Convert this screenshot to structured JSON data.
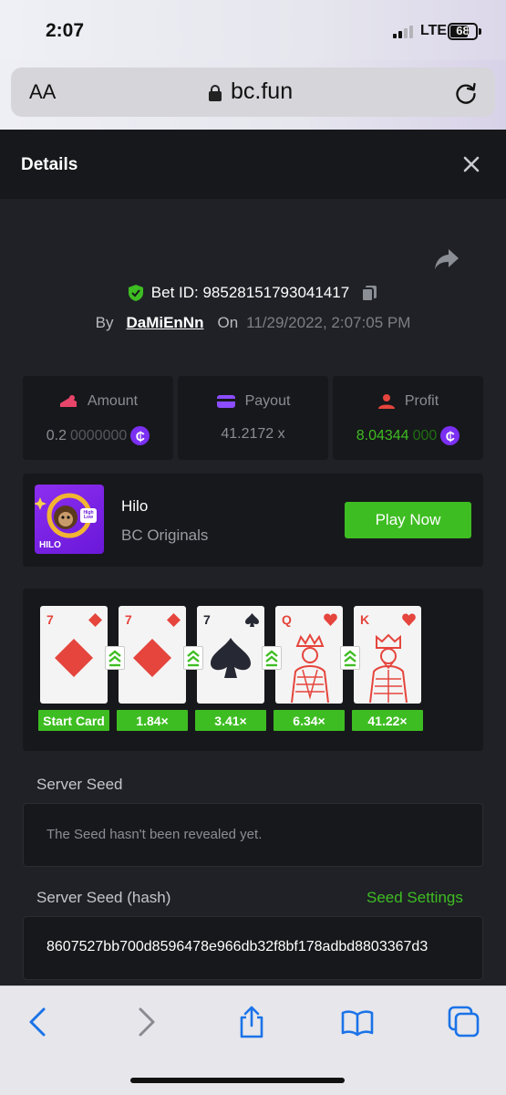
{
  "status_bar": {
    "time": "2:07",
    "network": "LTE",
    "battery": "68"
  },
  "browser": {
    "text_size": "AA",
    "url": "bc.fun"
  },
  "modal": {
    "title": "Details"
  },
  "bet": {
    "id_label": "Bet ID: 98528151793041417",
    "by_label": "By",
    "username": "DaMiEnNn",
    "on_label": "On",
    "datetime": "11/29/2022, 2:07:05 PM"
  },
  "stats": {
    "amount": {
      "label": "Amount",
      "value_lead": "0.2",
      "value_trail": "0000000"
    },
    "payout": {
      "label": "Payout",
      "value": "41.2172 x"
    },
    "profit": {
      "label": "Profit",
      "value_lead": "8.04344",
      "value_trail": "000"
    },
    "coin_symbol": "₵"
  },
  "game": {
    "name": "Hilo",
    "provider": "BC Originals",
    "play_label": "Play Now",
    "thumb_label": "HILO",
    "thumb_badge": "High Low"
  },
  "cards": [
    {
      "rank": "7",
      "suit": "diamond",
      "multiplier": "Start Card"
    },
    {
      "rank": "7",
      "suit": "diamond",
      "multiplier": "1.84×"
    },
    {
      "rank": "7",
      "suit": "spade",
      "multiplier": "3.41×"
    },
    {
      "rank": "Q",
      "suit": "heart",
      "multiplier": "6.34×"
    },
    {
      "rank": "K",
      "suit": "heart",
      "multiplier": "41.22×"
    }
  ],
  "server_seed": {
    "label": "Server Seed",
    "message": "The Seed hasn't been revealed yet."
  },
  "server_seed_hash": {
    "label": "Server Seed (hash)",
    "settings_link": "Seed Settings",
    "value": "8607527bb700d8596478e966db32f8bf178adbd8803367d3"
  },
  "colors": {
    "accent_green": "#3ebd22",
    "coin_purple": "#7b2ff2",
    "card_red": "#e5453d"
  }
}
